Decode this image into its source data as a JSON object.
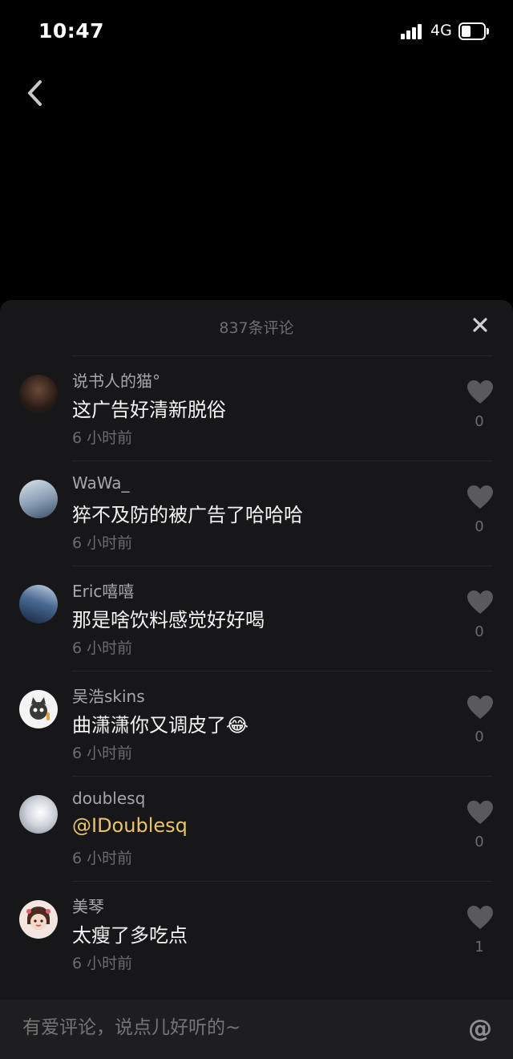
{
  "status_bar": {
    "time": "10:47",
    "network": "4G"
  },
  "sheet": {
    "comment_count_label": "837条评论"
  },
  "comments": [
    {
      "username": "说书人的猫°",
      "text": "这广告好清新脱俗",
      "time": "6 小时前",
      "likes": "0",
      "avatar_color": "#3a2a22"
    },
    {
      "username": "WaWa_",
      "text": "猝不及防的被广告了哈哈哈",
      "time": "6 小时前",
      "likes": "0",
      "avatar_color": "#8fa3b8"
    },
    {
      "username": "Eric嘻嘻",
      "text": "那是啥饮料感觉好好喝",
      "time": "6 小时前",
      "likes": "0",
      "avatar_color": "#2d4870"
    },
    {
      "username": "吴浩skins",
      "text": "曲潇潇你又调皮了😂",
      "time": "6 小时前",
      "likes": "0",
      "avatar_color": "#f2f2f2"
    },
    {
      "username": "doublesq",
      "text": "@IDoublesq",
      "time": "6 小时前",
      "likes": "0",
      "avatar_color": "#c7ccd6"
    },
    {
      "username": "美琴",
      "text": "太瘦了多吃点",
      "time": "6 小时前",
      "likes": "1",
      "avatar_color": "#e8c9c0"
    }
  ],
  "input": {
    "placeholder": "有爱评论，说点儿好听的~"
  },
  "colors": {
    "sheet_bg": "#171719",
    "mention": "#e9c46a",
    "muted": "#6b6b70"
  }
}
